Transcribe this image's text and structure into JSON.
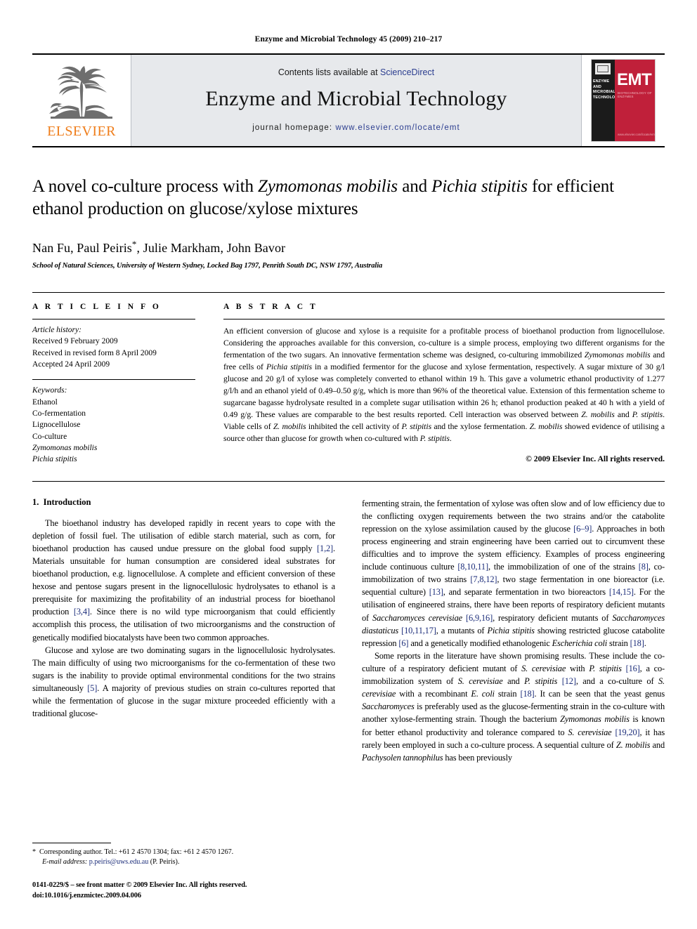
{
  "running_head": "Enzyme and Microbial Technology 45 (2009) 210–217",
  "masthead": {
    "publisher_logo_label": "ELSEVIER",
    "contents_prefix": "Contents lists available at ",
    "contents_link": "ScienceDirect",
    "journal_title": "Enzyme and Microbial Technology",
    "homepage_prefix": "journal homepage: ",
    "homepage_url": "www.elsevier.com/locate/emt",
    "cover": {
      "spine_title": "ENZYME AND MICROBIAL TECHNOLOGY",
      "abbrev": "EMT",
      "sub_line": "BIOTECHNOLOGY OF ENZYMES",
      "foot_line": "www.elsevier.com/locate/emt"
    },
    "link_color": "#2b3d8f",
    "cover_red": "#c0203a",
    "elsevier_orange": "#ef7d1a"
  },
  "article": {
    "title_part1": "A novel co-culture process with ",
    "title_species1": "Zymomonas mobilis",
    "title_part2": " and ",
    "title_species2": "Pichia stipitis",
    "title_part3": " for efficient ethanol production on glucose/xylose mixtures",
    "authors": "Nan Fu, Paul Peiris",
    "corresponding_marker": "*",
    "authors_rest": ", Julie Markham, John Bavor",
    "affiliation": "School of Natural Sciences, University of Western Sydney, Locked Bag 1797, Penrith South DC, NSW 1797, Australia"
  },
  "article_info": {
    "heading": "A R T I C L E   I N F O",
    "history_label": "Article history:",
    "history": [
      "Received 9 February 2009",
      "Received in revised form 8 April 2009",
      "Accepted 24 April 2009"
    ],
    "keywords_label": "Keywords:",
    "keywords": [
      "Ethanol",
      "Co-fermentation",
      "Lignocellulose",
      "Co-culture"
    ],
    "keywords_italic": [
      "Zymomonas mobilis",
      "Pichia stipitis"
    ]
  },
  "abstract": {
    "heading": "A B S T R A C T",
    "p1a": "An efficient conversion of glucose and xylose is a requisite for a profitable process of bioethanol production from lignocellulose. Considering the approaches available for this conversion, co-culture is a simple process, employing two different organisms for the fermentation of the two sugars. An innovative fermentation scheme was designed, co-culturing immobilized ",
    "sp1": "Zymomonas mobilis",
    "p1b": " and free cells of ",
    "sp2": "Pichia stipitis",
    "p1c": " in a modified fermentor for the glucose and xylose fermentation, respectively. A sugar mixture of 30 g/l glucose and 20 g/l of xylose was completely converted to ethanol within 19 h. This gave a volumetric ethanol productivity of 1.277 g/l/h and an ethanol yield of 0.49–0.50 g/g, which is more than 96% of the theoretical value. Extension of this fermentation scheme to sugarcane bagasse hydrolysate resulted in a complete sugar utilisation within 26 h; ethanol production peaked at 40 h with a yield of 0.49 g/g. These values are comparable to the best results reported. Cell interaction was observed between ",
    "sp3": "Z. mobilis",
    "p1d": " and ",
    "sp4": "P. stipitis",
    "p1e": ". Viable cells of ",
    "sp5": "Z. mobilis",
    "p1f": " inhibited the cell activity of ",
    "sp6": "P. stipitis",
    "p1g": " and the xylose fermentation. ",
    "sp7": "Z. mobilis",
    "p1h": " showed evidence of utilising a source other than glucose for growth when co-cultured with ",
    "sp8": "P. stipitis",
    "p1i": ".",
    "copyright": "© 2009 Elsevier Inc. All rights reserved."
  },
  "introduction": {
    "section_number": "1.",
    "section_title": "Introduction",
    "left": {
      "p1_a": "The bioethanol industry has developed rapidly in recent years to cope with the depletion of fossil fuel. The utilisation of edible starch material, such as corn, for bioethanol production has caused undue pressure on the global food supply ",
      "p1_ref1": "[1,2]",
      "p1_b": ". Materials unsuitable for human consumption are considered ideal substrates for bioethanol production, e.g. lignocellulose. A complete and efficient conversion of these hexose and pentose sugars present in the lignocellulosic hydrolysates to ethanol is a prerequisite for maximizing the profitability of an industrial process for bioethanol production ",
      "p1_ref2": "[3,4]",
      "p1_c": ". Since there is no wild type microorganism that could efficiently accomplish this process, the utilisation of two microorganisms and the construction of genetically modified biocatalysts have been two common approaches.",
      "p2_a": "Glucose and xylose are two dominating sugars in the lignocellulosic hydrolysates. The main difficulty of using two microorganisms for the co-fermentation of these two sugars is the inability to provide optimal environmental conditions for the two strains simultaneously ",
      "p2_ref1": "[5]",
      "p2_b": ". A majority of previous studies on strain co-cultures reported that while the fermentation of glucose in the sugar mixture proceeded efficiently with a traditional glucose-"
    },
    "right": {
      "p3_a": "fermenting strain, the fermentation of xylose was often slow and of low efficiency due to the conflicting oxygen requirements between the two strains and/or the catabolite repression on the xylose assimilation caused by the glucose ",
      "p3_ref1": "[6–9]",
      "p3_b": ". Approaches in both process engineering and strain engineering have been carried out to circumvent these difficulties and to improve the system efficiency. Examples of process engineering include continuous culture ",
      "p3_ref2": "[8,10,11]",
      "p3_c": ", the immobilization of one of the strains ",
      "p3_ref3": "[8]",
      "p3_d": ", co-immobilization of two strains ",
      "p3_ref4": "[7,8,12]",
      "p3_e": ", two stage fermentation in one bioreactor (i.e. sequential culture) ",
      "p3_ref5": "[13]",
      "p3_f": ", and separate fermentation in two bioreactors ",
      "p3_ref6": "[14,15]",
      "p3_g": ". For the utilisation of engineered strains, there have been reports of respiratory deficient mutants of ",
      "p3_sp1": "Saccharomyces cerevisiae",
      "p3_ref7": "[6,9,16]",
      "p3_h": ", respiratory deficient mutants of ",
      "p3_sp2": "Saccharomyces diastaticus",
      "p3_ref8": "[10,11,17]",
      "p3_i": ", a mutants of ",
      "p3_sp3": "Pichia stipitis",
      "p3_j": " showing restricted glucose catabolite repression ",
      "p3_ref9": "[6]",
      "p3_k": " and a genetically modified ethanologenic ",
      "p3_sp4": "Escherichia coli",
      "p3_l": " strain ",
      "p3_ref10": "[18]",
      "p3_m": ".",
      "p4_a": "Some reports in the literature have shown promising results. These include the co-culture of a respiratory deficient mutant of ",
      "p4_sp1": "S. cerevisiae",
      "p4_b": " with ",
      "p4_sp2": "P. stipitis",
      "p4_ref1": "[16]",
      "p4_c": ", a co-immobilization system of ",
      "p4_sp3": "S. cerevisiae",
      "p4_d": " and ",
      "p4_sp4": "P. stipitis",
      "p4_ref2": "[12]",
      "p4_e": ", and a co-culture of ",
      "p4_sp5": "S. cerevisiae",
      "p4_f": " with a recombinant ",
      "p4_sp6": "E. coli",
      "p4_g": " strain ",
      "p4_ref3": "[18]",
      "p4_h": ". It can be seen that the yeast genus ",
      "p4_sp7": "Saccharomyces",
      "p4_i": " is preferably used as the glucose-fermenting strain in the co-culture with another xylose-fermenting strain. Though the bacterium ",
      "p4_sp8": "Zymomonas mobilis",
      "p4_j": " is known for better ethanol productivity and tolerance compared to ",
      "p4_sp9": "S. cerevisiae",
      "p4_ref4": "[19,20]",
      "p4_k": ", it has rarely been employed in such a co-culture process. A sequential culture of ",
      "p4_sp10": "Z. mobilis",
      "p4_l": " and ",
      "p4_sp11": "Pachysolen tannophilus",
      "p4_m": " has been previously"
    }
  },
  "footnote": {
    "star": "*",
    "corresponding": "Corresponding author. Tel.: +61 2 4570 1304; fax: +61 2 4570 1267.",
    "email_label": "E-mail address:",
    "email": "p.peiris@uws.edu.au",
    "email_owner": "(P. Peiris)."
  },
  "imprint": {
    "front_matter": "0141-0229/$ – see front matter © 2009 Elsevier Inc. All rights reserved.",
    "doi": "doi:10.1016/j.enzmictec.2009.04.006"
  }
}
